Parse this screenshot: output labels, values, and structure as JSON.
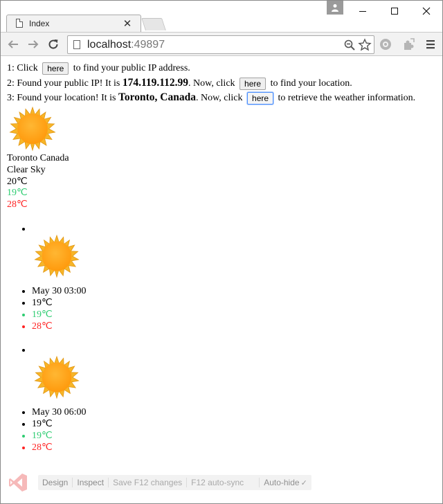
{
  "browser": {
    "tab_title": "Index",
    "url_host": "localhost",
    "url_port": ":49897"
  },
  "page": {
    "step1": {
      "prefix": "1: Click",
      "button": "here",
      "suffix": "to find your public IP address."
    },
    "step2": {
      "prefix": "2: Found your public IP! It is",
      "ip": "174.119.112.99",
      "middle": ". Now, click",
      "button": "here",
      "suffix": "to find your location."
    },
    "step3": {
      "prefix": "3: Found your location! It is",
      "location": "Toronto, Canada",
      "middle": ". Now, click",
      "button": "here",
      "suffix": "to retrieve the weather information."
    },
    "current": {
      "icon": "sun-icon",
      "city": "Toronto Canada",
      "description": "Clear Sky",
      "temp": "20℃",
      "temp_min": "19℃",
      "temp_max": "28℃"
    },
    "forecast": [
      {
        "icon": "sun-icon",
        "time": "May 30 03:00",
        "temp": "19℃",
        "temp_min": "19℃",
        "temp_max": "28℃"
      },
      {
        "icon": "sun-icon",
        "time": "May 30 06:00",
        "temp": "19℃",
        "temp_min": "19℃",
        "temp_max": "28℃"
      }
    ]
  },
  "browser_link": {
    "design": "Design",
    "inspect": "Inspect",
    "save": "Save F12 changes",
    "autosync": "F12 auto-sync",
    "autohide": "Auto-hide",
    "autohide_check": "✓"
  },
  "colors": {
    "min_temp": "#2ecc71",
    "max_temp": "#ff2323",
    "sun_core": "#ffa31a",
    "sun_rays": "#f6b021"
  }
}
